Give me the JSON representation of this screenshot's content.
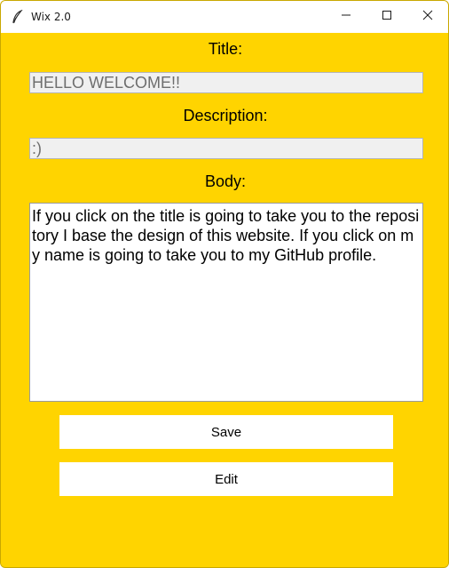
{
  "window": {
    "title": "Wix 2.0",
    "icon": "feather-icon",
    "controls": [
      "minimize-icon",
      "maximize-icon",
      "close-icon"
    ]
  },
  "form": {
    "title_label": "Title:",
    "title_value": "HELLO WELCOME!!",
    "description_label": "Description:",
    "description_value": ":)",
    "body_label": "Body:",
    "body_value": "If you click on the title is going to take you to the repository I base the design of this website. If you click on my name is going to take you to my GitHub profile."
  },
  "buttons": {
    "save_label": "Save",
    "edit_label": "Edit"
  },
  "colors": {
    "background": "#FFD400",
    "entry_background": "#f0f0f0",
    "button_background": "#ffffff"
  }
}
